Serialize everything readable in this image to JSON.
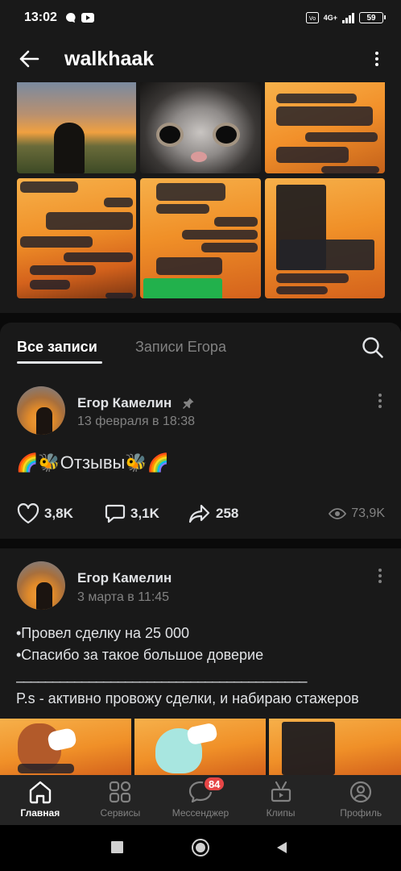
{
  "status_bar": {
    "time": "13:02",
    "network": "4G+",
    "battery": "59"
  },
  "header": {
    "title": "walkhaak"
  },
  "tabs": {
    "all_posts": "Все записи",
    "owner_posts": "Записи Егора"
  },
  "posts": [
    {
      "author": "Егор Камелин",
      "date": "13 февраля в 18:38",
      "pinned": true,
      "text": "🌈🐝Отзывы🐝🌈",
      "likes": "3,8K",
      "comments": "3,1K",
      "shares": "258",
      "views": "73,9K"
    },
    {
      "author": "Егор Камелин",
      "date": "3 марта в 11:45",
      "lines": [
        "•Провел сделку на 25 000",
        "•Спасибо за такое большое доверие",
        "________________________________________",
        "P.s - активно провожу сделки, и набираю стажеров"
      ]
    }
  ],
  "bottom_nav": [
    {
      "label": "Главная",
      "icon": "home-icon",
      "active": true
    },
    {
      "label": "Сервисы",
      "icon": "services-icon"
    },
    {
      "label": "Мессенджер",
      "icon": "messenger-icon",
      "badge": "84"
    },
    {
      "label": "Клипы",
      "icon": "clips-icon"
    },
    {
      "label": "Профиль",
      "icon": "profile-icon"
    }
  ],
  "colors": {
    "background": "#0a0a0a",
    "surface": "#191919",
    "text": "#e1e3e6",
    "secondary": "#828282",
    "badge": "#e64646"
  }
}
